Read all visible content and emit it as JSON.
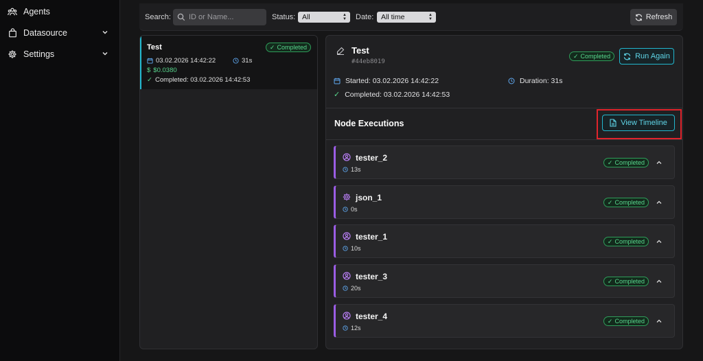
{
  "sidebar": {
    "items": [
      {
        "label": "Agents",
        "icon": "agents-icon"
      },
      {
        "label": "Datasource",
        "icon": "datasource-icon",
        "expandable": true
      },
      {
        "label": "Settings",
        "icon": "settings-icon",
        "expandable": true
      }
    ]
  },
  "filters": {
    "search_label": "Search:",
    "search_placeholder": "ID or Name...",
    "status_label": "Status:",
    "status_value": "All",
    "date_label": "Date:",
    "date_value": "All time",
    "refresh_label": "Refresh"
  },
  "runs": [
    {
      "name": "Test",
      "status": "Completed",
      "date": "03.02.2026 14:42:22",
      "duration": "31s",
      "cost": "$0.0380",
      "completed": "Completed: 03.02.2026 14:42:53"
    }
  ],
  "detail": {
    "title": "Test",
    "id": "#44eb8019",
    "status": "Completed",
    "run_again_label": "Run Again",
    "started": "Started: 03.02.2026 14:42:22",
    "duration": "Duration: 31s",
    "completed": "Completed: 03.02.2026 14:42:53",
    "section_title": "Node Executions",
    "view_timeline_label": "View Timeline",
    "nodes": [
      {
        "name": "tester_2",
        "duration": "13s",
        "status": "Completed",
        "icon": "user-icon"
      },
      {
        "name": "json_1",
        "duration": "0s",
        "status": "Completed",
        "icon": "gear-icon"
      },
      {
        "name": "tester_1",
        "duration": "10s",
        "status": "Completed",
        "icon": "user-icon"
      },
      {
        "name": "tester_3",
        "duration": "20s",
        "status": "Completed",
        "icon": "user-icon"
      },
      {
        "name": "tester_4",
        "duration": "12s",
        "status": "Completed",
        "icon": "user-icon"
      }
    ]
  },
  "colors": {
    "accent": "#22b8cf",
    "success": "#58d68d",
    "node_accent": "#9b5de5",
    "highlight": "#e0242c"
  }
}
